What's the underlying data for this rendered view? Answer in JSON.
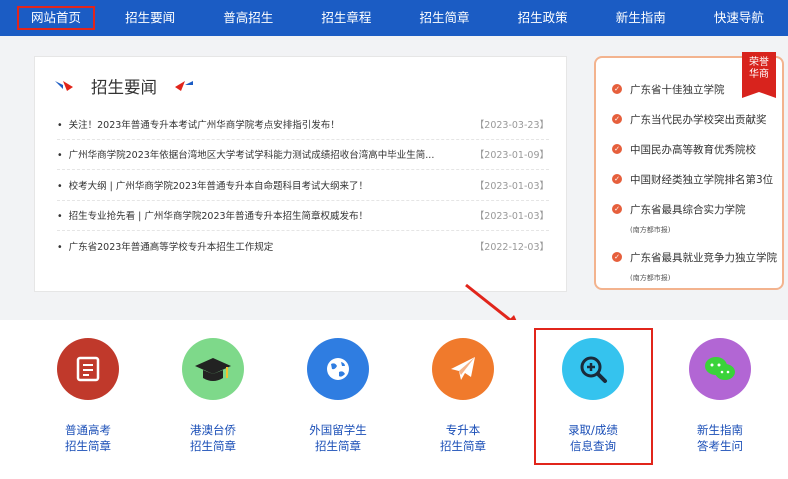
{
  "nav": {
    "items": [
      "网站首页",
      "招生要闻",
      "普高招生",
      "招生章程",
      "招生简章",
      "招生政策",
      "新生指南",
      "快速导航"
    ]
  },
  "news": {
    "title": "招生要闻",
    "items": [
      {
        "text": "关注！2023年普通专升本考试广州华商学院考点安排指引发布！",
        "date": "【2023-03-23】"
      },
      {
        "text": "广州华商学院2023年依据台湾地区大学考试学科能力测试成绩招收台湾高中毕业生简...",
        "date": "【2023-01-09】"
      },
      {
        "text": "校考大纲 | 广州华商学院2023年普通专升本自命题科目考试大纲来了！",
        "date": "【2023-01-03】"
      },
      {
        "text": "招生专业抢先看 | 广州华商学院2023年普通专升本招生简章权威发布！",
        "date": "【2023-01-03】"
      },
      {
        "text": "广东省2023年普通高等学校专升本招生工作规定",
        "date": "【2022-12-03】"
      }
    ]
  },
  "honor": {
    "ribbon": [
      "荣誉",
      "华商"
    ],
    "items": [
      {
        "text": "广东省十佳独立学院",
        "sub": ""
      },
      {
        "text": "广东当代民办学校突出贡献奖",
        "sub": ""
      },
      {
        "text": "中国民办高等教育优秀院校",
        "sub": ""
      },
      {
        "text": "中国财经类独立学院排名第3位",
        "sub": ""
      },
      {
        "text": "广东省最具综合实力学院",
        "sub": "(南方都市报)"
      },
      {
        "text": "广东省最具就业竞争力独立学院",
        "sub": "(南方都市报)"
      }
    ]
  },
  "entries": [
    {
      "line1": "普通高考",
      "line2": "招生简章",
      "icon": "document-icon",
      "color": "#c0392b"
    },
    {
      "line1": "港澳台侨",
      "line2": "招生简章",
      "icon": "graduation-cap-icon",
      "color": "#7ed98a"
    },
    {
      "line1": "外国留学生",
      "line2": "招生简章",
      "icon": "globe-icon",
      "color": "#2f7de1"
    },
    {
      "line1": "专升本",
      "line2": "招生简章",
      "icon": "paper-plane-icon",
      "color": "#f07a2c"
    },
    {
      "line1": "录取/成绩",
      "line2": "信息查询",
      "icon": "magnifier-plus-icon",
      "color": "#35c3ee"
    },
    {
      "line1": "新生指南",
      "line2": "答考生问",
      "icon": "chat-icon",
      "color": "#b266d4"
    }
  ]
}
